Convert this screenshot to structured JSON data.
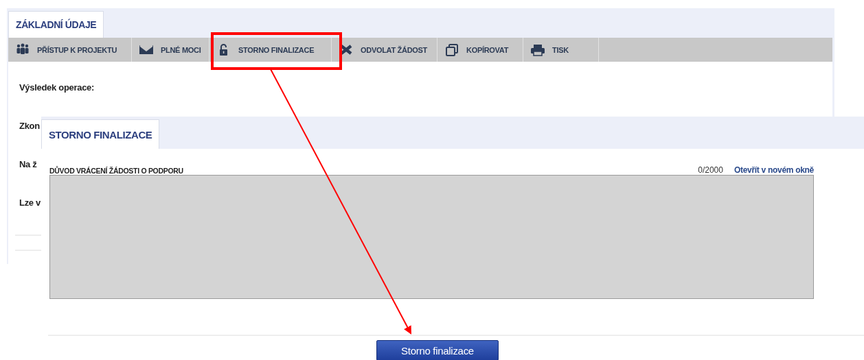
{
  "main_panel": {
    "tabs": [
      {
        "label": "ZÁKLADNÍ ÚDAJE",
        "selected": true
      }
    ],
    "toolbar": [
      {
        "label": "PŘÍSTUP K PROJEKTU"
      },
      {
        "label": "PLNÉ MOCI"
      },
      {
        "label": "STORNO FINALIZACE"
      },
      {
        "label": "ODVOLAT ŽÁDOST"
      },
      {
        "label": "KOPÍROVAT"
      },
      {
        "label": "TISK"
      }
    ],
    "fields": [
      {
        "label": "Výsledek operace:"
      },
      {
        "label": "Zkon"
      },
      {
        "label": "Na ž"
      },
      {
        "label": "Lze v"
      }
    ]
  },
  "dialog": {
    "tabs": [
      {
        "label": "STORNO FINALIZACE",
        "selected": true
      }
    ],
    "field": {
      "label": "DŮVOD VRÁCENÍ ŽÁDOSTI O PODPORU",
      "counter": "0/2000",
      "link": "Otevřít v novém okně"
    },
    "button": "Storno finalizace"
  }
}
